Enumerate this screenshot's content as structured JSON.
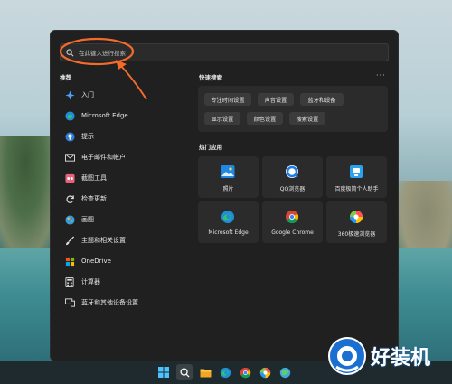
{
  "search": {
    "placeholder": "在此键入进行搜索"
  },
  "recommended": {
    "title": "推荐",
    "items": [
      {
        "label": "入门",
        "icon": "get-started-icon"
      },
      {
        "label": "Microsoft Edge",
        "icon": "edge-icon"
      },
      {
        "label": "提示",
        "icon": "tips-icon"
      },
      {
        "label": "电子邮件和帐户",
        "icon": "mail-icon"
      },
      {
        "label": "截图工具",
        "icon": "snipping-tool-icon"
      },
      {
        "label": "检查更新",
        "icon": "update-icon"
      },
      {
        "label": "画图",
        "icon": "paint-icon"
      },
      {
        "label": "主题和相关设置",
        "icon": "brush-icon"
      },
      {
        "label": "OneDrive",
        "icon": "onedrive-icon"
      },
      {
        "label": "计算器",
        "icon": "calculator-icon"
      },
      {
        "label": "蓝牙和其他设备设置",
        "icon": "bluetooth-devices-icon"
      }
    ]
  },
  "quick_search": {
    "title": "快速搜索",
    "more": "···",
    "chips": [
      "专注时间设置",
      "声音设置",
      "蓝牙和设备",
      "显示设置",
      "颜色设置",
      "搜索设置"
    ]
  },
  "top_apps": {
    "title": "热门应用",
    "apps": [
      {
        "label": "照片",
        "icon": "photos-icon"
      },
      {
        "label": "QQ浏览器",
        "icon": "qq-browser-icon"
      },
      {
        "label": "百度极简个人助手",
        "icon": "baidu-assistant-icon"
      },
      {
        "label": "Microsoft Edge",
        "icon": "edge-icon"
      },
      {
        "label": "Google Chrome",
        "icon": "chrome-icon"
      },
      {
        "label": "360极速浏览器",
        "icon": "360-browser-icon"
      }
    ]
  },
  "taskbar": {
    "icons": [
      "windows-start-icon",
      "search-icon",
      "file-explorer-icon",
      "edge-icon",
      "chrome-icon",
      "360-browser-icon",
      "browser-icon"
    ]
  },
  "watermark": {
    "text": "好装机"
  },
  "colors": {
    "accent": "#5db0ff",
    "annotation": "#f26b2a",
    "panel": "#202020"
  }
}
